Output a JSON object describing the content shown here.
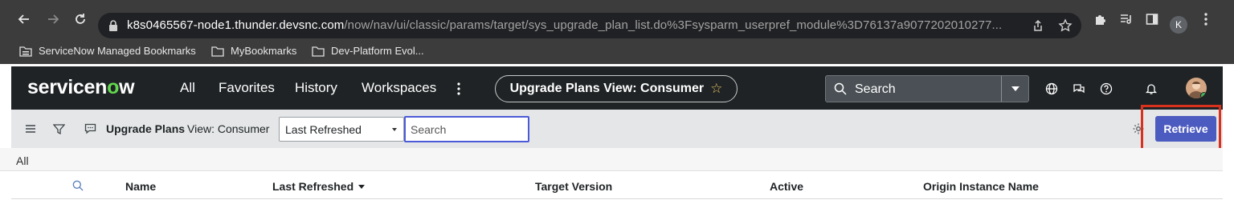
{
  "browser": {
    "url_host": "k8s0465567-node1.thunder.devsnc.com",
    "url_path": "/now/nav/ui/classic/params/target/sys_upgrade_plan_list.do%3Fsysparm_userpref_module%3D76137a9077202010277...",
    "profile_initial": "K",
    "bookmarks": [
      {
        "label": "ServiceNow Managed Bookmarks",
        "icon": "managed-folder-icon"
      },
      {
        "label": "MyBookmarks",
        "icon": "folder-icon"
      },
      {
        "label": "Dev-Platform Evol...",
        "icon": "folder-icon"
      }
    ]
  },
  "header": {
    "logo_before": "servicen",
    "logo_o": "o",
    "logo_after": "w",
    "nav": [
      "All",
      "Favorites",
      "History",
      "Workspaces"
    ],
    "context_title": "Upgrade Plans View: Consumer",
    "context_star": "☆",
    "search_placeholder": "Search"
  },
  "toolbar": {
    "list_title": "Upgrade Plans",
    "view_label": "View: Consumer",
    "field_value": "Last Refreshed",
    "search_placeholder": "Search",
    "retrieve_label": "Retrieve"
  },
  "breadcrumb": "All",
  "columns": [
    "Name",
    "Last Refreshed",
    "Target Version",
    "Active",
    "Origin Instance Name"
  ],
  "colors": {
    "chrome_bg": "#3c3c3c",
    "sn_header_bg": "#1f2325",
    "sn_green": "#62d84e",
    "retrieve_bg": "#4c5bbf",
    "highlight": "#d8311e"
  }
}
